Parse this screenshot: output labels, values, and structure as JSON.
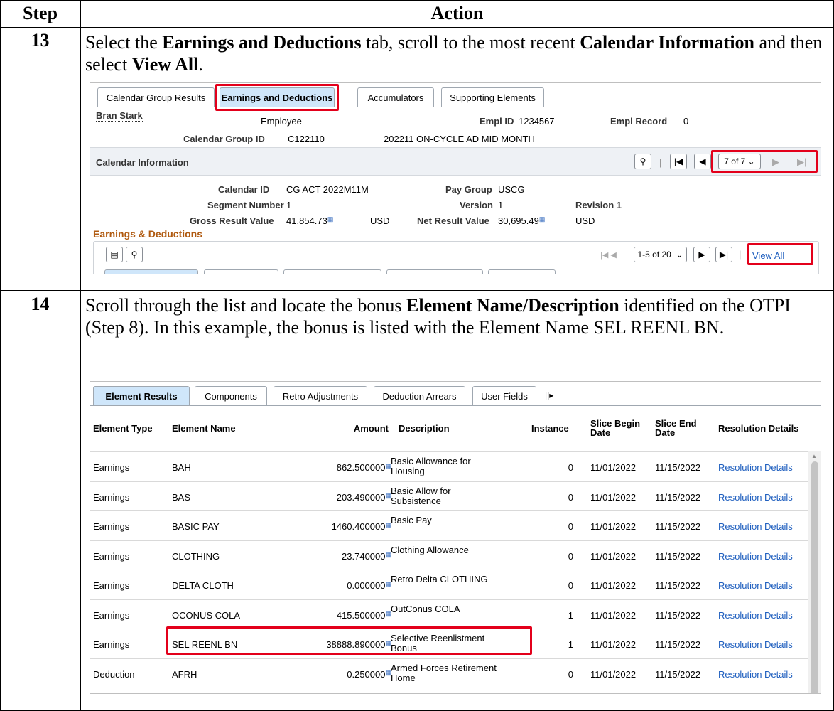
{
  "header": {
    "step": "Step",
    "action": "Action"
  },
  "step13": {
    "number": "13",
    "text_parts": [
      "Select the ",
      "Earnings and Deductions",
      " tab, scroll to the most recent ",
      "Calendar Information",
      " and then select ",
      "View All",
      "."
    ],
    "tabs": [
      "Calendar Group Results",
      "Earnings and Deductions",
      "Accumulators",
      "Supporting Elements"
    ],
    "employee_name": "Bran Stark",
    "employee_label": "Employee",
    "empl_id_label": "Empl ID",
    "empl_id": "1234567",
    "empl_record_label": "Empl Record",
    "empl_record": "0",
    "calendar_group_id_label": "Calendar Group ID",
    "calendar_group_id": "C122110",
    "calendar_group_desc": "202211 ON-CYCLE AD MID MONTH",
    "calendar_info_title": "Calendar Information",
    "pager": "7 of 7",
    "calendar_id_label": "Calendar ID",
    "calendar_id": "CG ACT 2022M11M",
    "pay_group_label": "Pay Group",
    "pay_group": "USCG",
    "segment_label": "Segment Number",
    "segment": "1",
    "version_label": "Version",
    "version": "1",
    "revision": "Revision 1",
    "gross_label": "Gross Result Value",
    "gross": "41,854.73",
    "gross_currency": "USD",
    "net_label": "Net Result Value",
    "net": "30,695.49",
    "net_currency": "USD",
    "earn_ded_title": "Earnings & Deductions",
    "rows_pager": "1-5 of 20",
    "view_all": "View All"
  },
  "step14": {
    "number": "14",
    "text_parts": [
      "Scroll through the list and locate the bonus ",
      "Element Name/Description",
      " identified on the OTPI (Step 8). In this example, the bonus is listed with the Element Name SEL REENL BN."
    ],
    "tabs": [
      "Element Results",
      "Components",
      "Retro Adjustments",
      "Deduction Arrears",
      "User Fields"
    ],
    "more_tabs_icon": "||▸",
    "columns": [
      "Element Type",
      "Element Name",
      "Amount",
      "Description",
      "Instance",
      "Slice Begin Date",
      "Slice End Date",
      "Resolution Details"
    ],
    "rows": [
      {
        "type": "Earnings",
        "name": "BAH",
        "amount": "862.500000",
        "desc": "Basic Allowance for Housing",
        "instance": "0",
        "begin": "11/01/2022",
        "end": "11/15/2022",
        "res": "Resolution Details"
      },
      {
        "type": "Earnings",
        "name": "BAS",
        "amount": "203.490000",
        "desc": "Basic Allow for Subsistence",
        "instance": "0",
        "begin": "11/01/2022",
        "end": "11/15/2022",
        "res": "Resolution Details"
      },
      {
        "type": "Earnings",
        "name": "BASIC PAY",
        "amount": "1460.400000",
        "desc": "Basic Pay",
        "instance": "0",
        "begin": "11/01/2022",
        "end": "11/15/2022",
        "res": "Resolution Details"
      },
      {
        "type": "Earnings",
        "name": "CLOTHING",
        "amount": "23.740000",
        "desc": "Clothing Allowance",
        "instance": "0",
        "begin": "11/01/2022",
        "end": "11/15/2022",
        "res": "Resolution Details"
      },
      {
        "type": "Earnings",
        "name": "DELTA CLOTH",
        "amount": "0.000000",
        "desc": "Retro Delta CLOTHING",
        "instance": "0",
        "begin": "11/01/2022",
        "end": "11/15/2022",
        "res": "Resolution Details"
      },
      {
        "type": "Earnings",
        "name": "OCONUS COLA",
        "amount": "415.500000",
        "desc": "OutConus COLA",
        "instance": "1",
        "begin": "11/01/2022",
        "end": "11/15/2022",
        "res": "Resolution Details"
      },
      {
        "type": "Earnings",
        "name": "SEL REENL BN",
        "amount": "38888.890000",
        "desc": "Selective Reenlistment Bonus",
        "instance": "1",
        "begin": "11/01/2022",
        "end": "11/15/2022",
        "res": "Resolution Details"
      },
      {
        "type": "Deduction",
        "name": "AFRH",
        "amount": "0.250000",
        "desc": "Armed Forces Retirement Home",
        "instance": "0",
        "begin": "11/01/2022",
        "end": "11/15/2022",
        "res": "Resolution Details"
      }
    ]
  },
  "colors": {
    "highlight": "#e3001b",
    "tab_active": "#cfe6fa",
    "link": "#1f5fbf"
  }
}
